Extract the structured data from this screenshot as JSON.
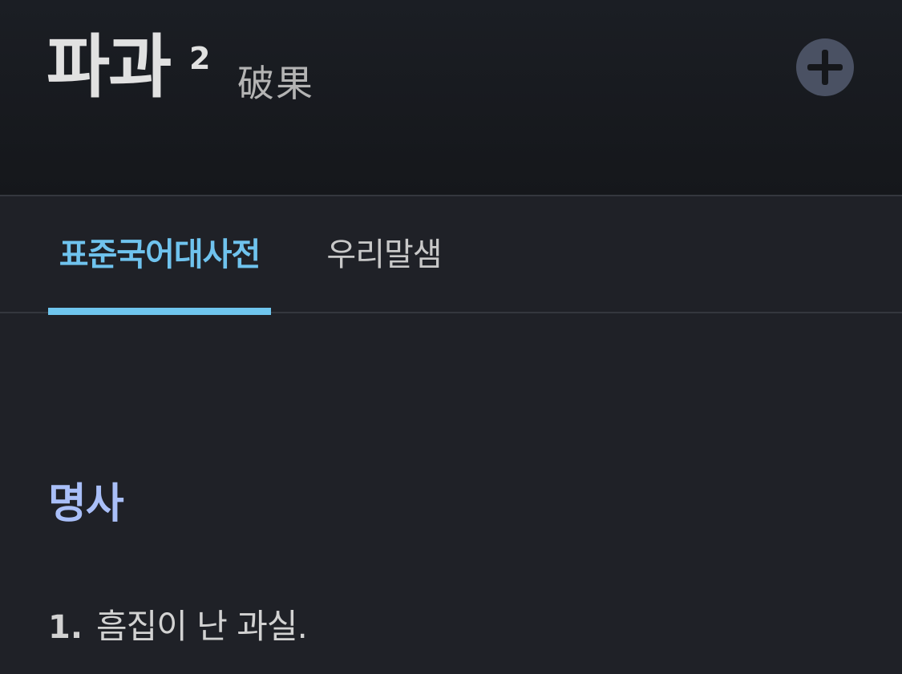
{
  "entry": {
    "headword": "파과",
    "homonym_number": "2",
    "hanja": "破果",
    "add_icon": "plus-circle-icon"
  },
  "tabs": [
    {
      "label": "표준국어대사전",
      "active": true
    },
    {
      "label": "우리말샘",
      "active": false
    }
  ],
  "definition": {
    "part_of_speech": "명사",
    "senses": [
      {
        "number": "1.",
        "text": "흠집이 난 과실."
      }
    ]
  },
  "colors": {
    "accent": "#6fc6ee",
    "pos_label": "#a9bff8",
    "background": "#1f2127",
    "header_background": "#15171b"
  }
}
